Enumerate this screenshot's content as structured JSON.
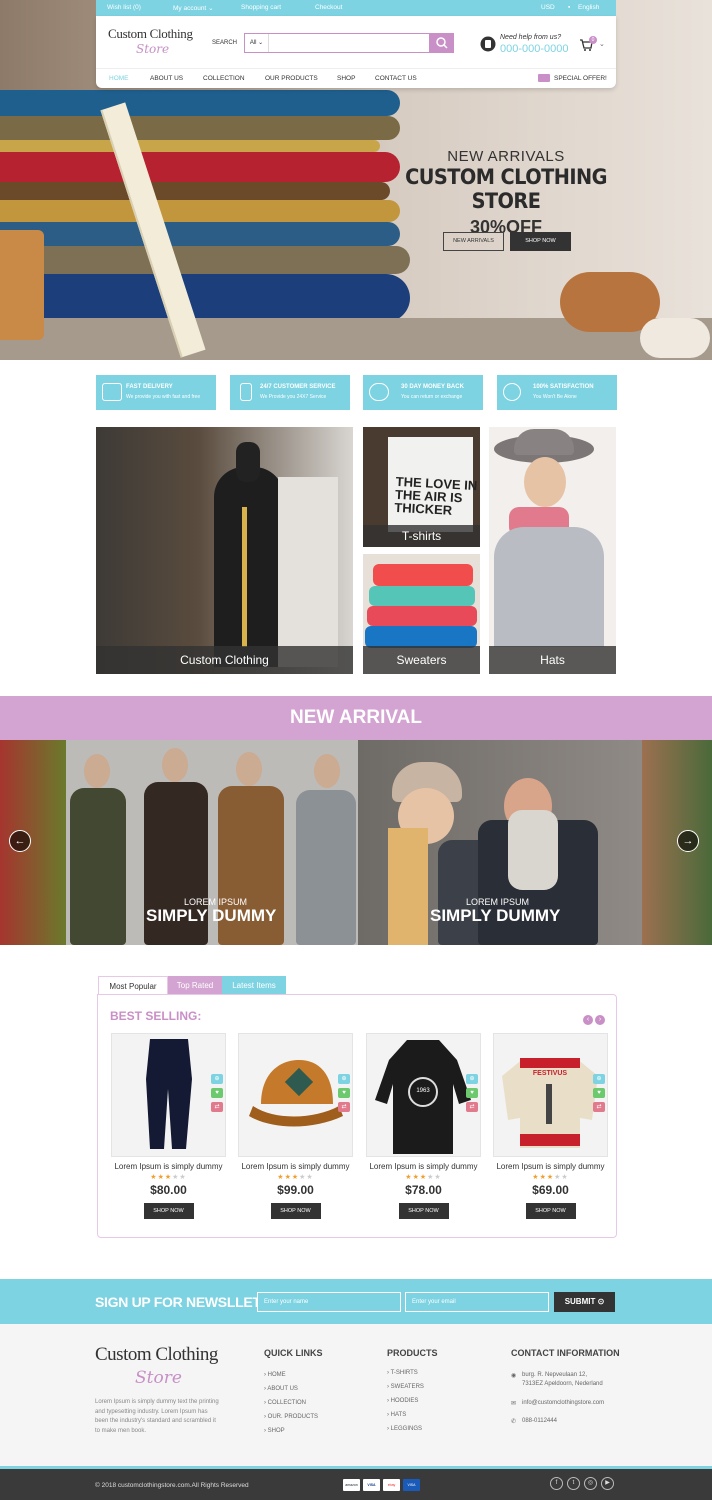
{
  "topbar": {
    "wishlist": "Wish list (0)",
    "account": "My account",
    "cart": "Shopping cart",
    "checkout": "Checkout",
    "currency": "USD",
    "language": "English"
  },
  "header": {
    "logo_title": "Custom Clothing",
    "logo_sub": "Store",
    "search_label": "SEARCH",
    "search_category": "All",
    "search_placeholder": "",
    "help_question": "Need help from us?",
    "help_phone": "000-000-0000",
    "cart_count": "0"
  },
  "nav": {
    "items": [
      "HOME",
      "ABOUT US",
      "COLLECTION",
      "OUR PRODUCTS",
      "SHOP",
      "CONTACT US"
    ],
    "special": "SPECIAL OFFER!"
  },
  "hero": {
    "subtitle": "NEW ARRIVALS",
    "title": "CUSTOM CLOTHING STORE",
    "offer": "30%OFF",
    "btn_arrivals": "NEW ARRIVALS",
    "btn_shop": "SHOP NOW"
  },
  "features": [
    {
      "title": "FAST DELIVERY",
      "desc": "We provide you with fast and free",
      "icon": "truck-icon"
    },
    {
      "title": "24/7 CUSTOMER SERVICE",
      "desc": "We Provide you 24X7 Service",
      "icon": "phone-icon"
    },
    {
      "title": "30 DAY MONEY BACK",
      "desc": "You can return or exchange",
      "icon": "money-hand-icon"
    },
    {
      "title": "100% SATISFACTION",
      "desc": "You Won't Be Alone",
      "icon": "badge-icon"
    }
  ],
  "categories": [
    "Custom Clothing",
    "T-shirts",
    "Sweaters",
    "Hats"
  ],
  "tshirt_print": "THE LOVE IN THE AIR IS THICKER",
  "new_arrival": {
    "title": "NEW ARRIVAL",
    "slides": [
      {
        "caption1": "LOREM IPSUM",
        "caption2": "SIMPLY DUMMY"
      },
      {
        "caption1": "LOREM IPSUM",
        "caption2": "SIMPLY DUMMY"
      }
    ]
  },
  "tabs": [
    "Most Popular",
    "Top Rated",
    "Latest Items"
  ],
  "best_selling": {
    "title": "BEST SELLING:",
    "products": [
      {
        "name": "Lorem Ipsum is simply dummy",
        "price": "$80.00",
        "rating": 3,
        "button": "SHOP NOW"
      },
      {
        "name": "Lorem Ipsum is simply dummy",
        "price": "$99.00",
        "rating": 3,
        "button": "SHOP NOW"
      },
      {
        "name": "Lorem Ipsum is simply dummy",
        "price": "$78.00",
        "rating": 3,
        "button": "SHOP NOW",
        "print": "1963"
      },
      {
        "name": "Lorem Ipsum is simply dummy",
        "price": "$69.00",
        "rating": 3,
        "button": "SHOP NOW",
        "print": "FESTIVUS"
      }
    ]
  },
  "newsletter": {
    "title": "SIGN UP FOR NEWSLLETER",
    "name_placeholder": "Enter your name",
    "email_placeholder": "Enter your email",
    "submit": "SUBMIT"
  },
  "footer": {
    "logo_title": "Custom Clothing",
    "logo_sub": "Store",
    "desc": "Lorem Ipsum is simply dummy text the printing and typesetting industry. Lorem Ipsum has been the industry's standard and scrambled it to make men book.",
    "quick_links_title": "QUICK LINKS",
    "quick_links": [
      "HOME",
      "ABOUT US",
      "COLLECTION",
      "OUR. PRODUCTS",
      "SHOP"
    ],
    "products_title": "PRODUCTS",
    "products": [
      "T-SHIRTS",
      "SWEATERS",
      "HOODIES",
      "HATS",
      "LEGGINGS"
    ],
    "contact_title": "CONTACT INFORMATION",
    "address1": "burg. R. Nepveulaan 12,",
    "address2": "7313EZ Apeldoorn, Nederland",
    "email": "info@customclothingstore.com",
    "phone": "088-0112444",
    "copyright": "© 2018 customclothingstore.com.All Rights Reserved",
    "payments": [
      "amazon",
      "VISA",
      "ebay",
      "VISA"
    ]
  },
  "colors": {
    "accent_blue": "#7dd3e2",
    "accent_pink": "#c98fc7",
    "band_pink": "#d3a3d1",
    "dark": "#333333"
  }
}
